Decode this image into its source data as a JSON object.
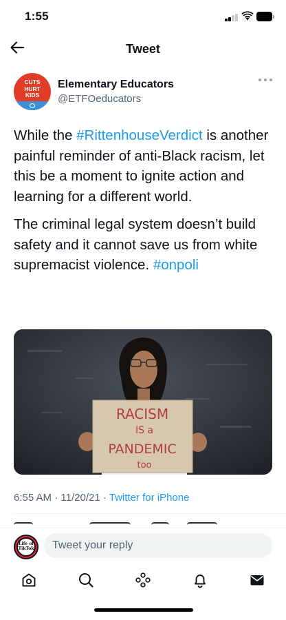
{
  "status_bar": {
    "time": "1:55"
  },
  "header": {
    "title": "Tweet",
    "back_icon": "arrow-left-icon"
  },
  "author": {
    "display_name": "Elementary Educators",
    "handle": "@ETFOeducators",
    "avatar_text": "CUTS HURT KIDS",
    "avatar_line1": "CUTS",
    "avatar_line2": "HURT",
    "avatar_line3": "KIDS",
    "avatar_color": "#e13c27",
    "avatar_strip_color": "#3c8fd6",
    "more_icon": "more-dots-icon"
  },
  "tweet": {
    "p1_before": "While the ",
    "p1_hashtag": "#RittenhouseVerdict",
    "p1_after": " is another painful reminder of anti-Black racism, let this be a moment to ignite action and learning for a different world.",
    "p2_text": "The criminal legal system doesn’t build safety and it cannot save us from white supremacist violence. ",
    "p2_hashtag": "#onpoli",
    "link_color": "#1d9bf0"
  },
  "media": {
    "sign_line1": "RACISM",
    "sign_line2": "IS a",
    "sign_line3": "PANDEMIC",
    "sign_line4": "too"
  },
  "meta": {
    "time": "6:55 AM",
    "separator": " · ",
    "date": "11/20/21",
    "app": "Twitter for iPhone"
  },
  "reply": {
    "placeholder": "Tweet your reply",
    "avatar_text": "Life of TikTok"
  },
  "tab_bar": {
    "items": [
      "home-icon",
      "search-icon",
      "spaces-icon",
      "notifications-icon",
      "messages-icon"
    ]
  }
}
